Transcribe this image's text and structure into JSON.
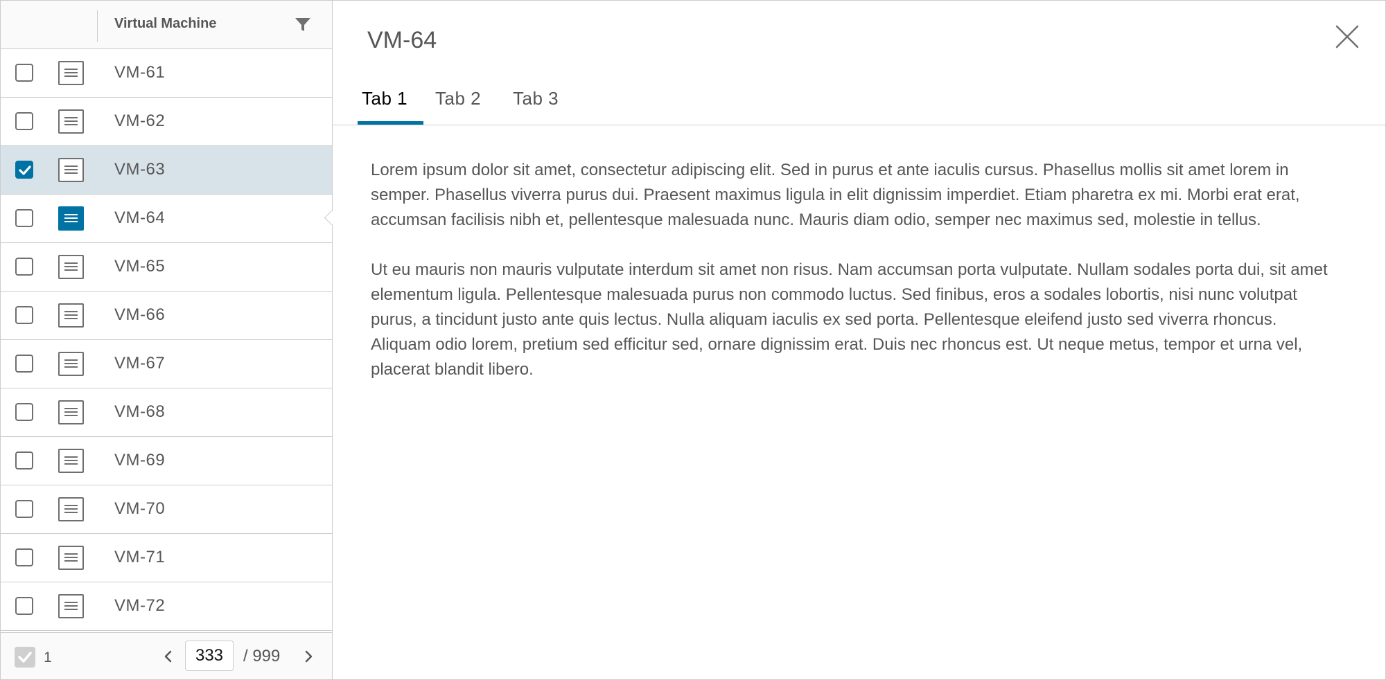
{
  "grid": {
    "column_header": "Virtual Machine",
    "rows": [
      {
        "label": "VM-61",
        "checked": false,
        "detail_open": false
      },
      {
        "label": "VM-62",
        "checked": false,
        "detail_open": false
      },
      {
        "label": "VM-63",
        "checked": true,
        "detail_open": false
      },
      {
        "label": "VM-64",
        "checked": false,
        "detail_open": true
      },
      {
        "label": "VM-65",
        "checked": false,
        "detail_open": false
      },
      {
        "label": "VM-66",
        "checked": false,
        "detail_open": false
      },
      {
        "label": "VM-67",
        "checked": false,
        "detail_open": false
      },
      {
        "label": "VM-68",
        "checked": false,
        "detail_open": false
      },
      {
        "label": "VM-69",
        "checked": false,
        "detail_open": false
      },
      {
        "label": "VM-70",
        "checked": false,
        "detail_open": false
      },
      {
        "label": "VM-71",
        "checked": false,
        "detail_open": false
      },
      {
        "label": "VM-72",
        "checked": false,
        "detail_open": false
      }
    ],
    "footer": {
      "selected_count": "1",
      "current_page": "333",
      "total_pages": "/ 999"
    }
  },
  "detail": {
    "title": "VM-64",
    "tabs": [
      {
        "label": "Tab 1",
        "active": true
      },
      {
        "label": "Tab 2",
        "active": false
      },
      {
        "label": "Tab 3",
        "active": false
      }
    ],
    "paragraphs": [
      "Lorem ipsum dolor sit amet, consectetur adipiscing elit. Sed in purus et ante iaculis cursus. Phasellus mollis sit amet lorem in semper. Phasellus viverra purus dui. Praesent maximus ligula in elit dignissim imperdiet. Etiam pharetra ex mi. Morbi erat erat, accumsan facilisis nibh et, pellentesque malesuada nunc. Mauris diam odio, semper nec maximus sed, molestie in tellus.",
      "Ut eu mauris non mauris vulputate interdum sit amet non risus. Nam accumsan porta vulputate. Nullam sodales porta dui, sit amet elementum ligula. Pellentesque malesuada purus non commodo luctus. Sed finibus, eros a sodales lobortis, nisi nunc volutpat purus, a tincidunt justo ante quis lectus. Nulla aliquam iaculis ex sed porta. Pellentesque eleifend justo sed viverra rhoncus. Aliquam odio lorem, pretium sed efficitur sed, ornare dignissim erat. Duis nec rhoncus est. Ut neque metus, tempor et urna vel, placerat blandit libero."
    ]
  },
  "icons": {
    "filter": "filter-icon",
    "row_detail": "detail-pane-icon",
    "checkbox": "checkbox-icon",
    "prev": "chevron-left-icon",
    "next": "chevron-right-icon",
    "close": "close-icon"
  },
  "colors": {
    "accent": "#0072a3",
    "selected_row": "#d8e3e9",
    "border": "#cccccc",
    "text": "#565656"
  }
}
